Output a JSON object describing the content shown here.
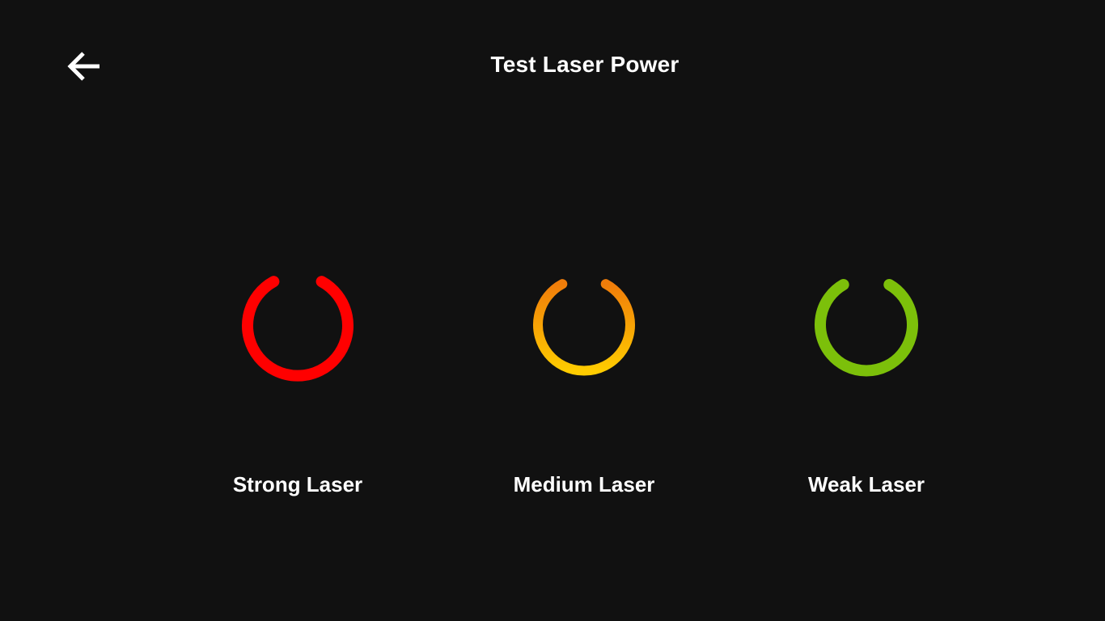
{
  "header": {
    "title": "Test Laser Power",
    "back_icon": "arrow-left-icon"
  },
  "options": [
    {
      "id": "strong",
      "label": "Strong Laser",
      "icon": "power-icon",
      "colors": [
        "#ff0000",
        "#ff0000"
      ]
    },
    {
      "id": "medium",
      "label": "Medium Laser",
      "icon": "power-icon",
      "colors": [
        "#f07d0a",
        "#ffcc00"
      ]
    },
    {
      "id": "weak",
      "label": "Weak Laser",
      "icon": "power-icon",
      "colors": [
        "#7cc00a",
        "#7cc00a"
      ]
    }
  ]
}
